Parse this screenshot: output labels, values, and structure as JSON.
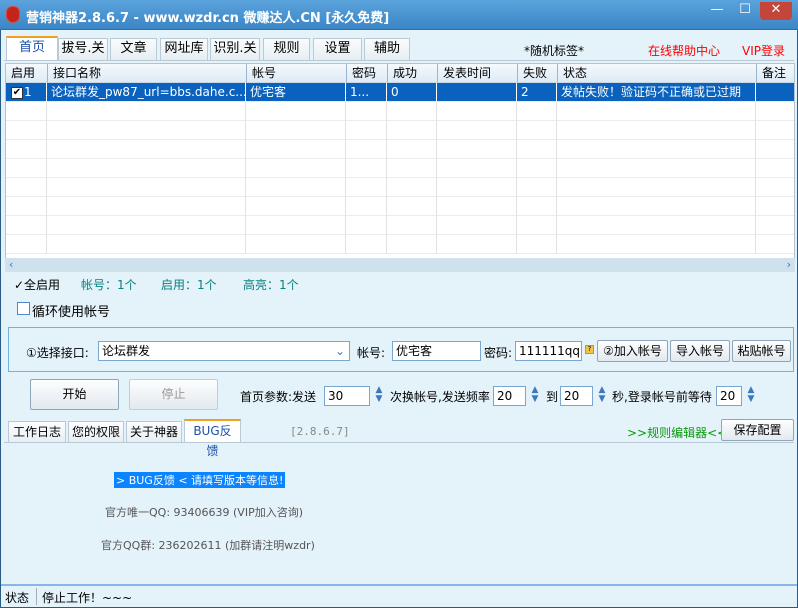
{
  "window": {
    "title": "营销神器2.8.6.7 - www.wzdr.cn 微赚达人.CN [永久免费]",
    "minimize": "—",
    "maximize": "☐",
    "close": "✕"
  },
  "tabs": [
    {
      "label": "首页"
    },
    {
      "label": "拔号.关"
    },
    {
      "label": "文章"
    },
    {
      "label": "网址库"
    },
    {
      "label": "识别.关"
    },
    {
      "label": "规则"
    },
    {
      "label": "设置"
    },
    {
      "label": "辅助"
    }
  ],
  "header_links": {
    "random_tag": "*随机标签*",
    "help": "在线帮助中心",
    "vip": "VIP登录"
  },
  "table": {
    "columns": [
      "启用",
      "接口名称",
      "帐号",
      "密码",
      "成功",
      "发表时间",
      "失败",
      "状态",
      "备注"
    ],
    "rows": [
      {
        "enabled": true,
        "index": "1",
        "name": "论坛群发_pw87_url=bbs.dahe.c...",
        "account": "优宅客",
        "password": "1...",
        "success": "0",
        "time": "",
        "fail": "2",
        "status": "发帖失败！验证码不正确或已过期",
        "note": ""
      }
    ]
  },
  "summary": {
    "enable_all": "✓全启用",
    "accounts": "帐号：1个",
    "enabled": "启用：1个",
    "highlighted": "高亮：1个"
  },
  "loop_accounts": {
    "label": "循环使用帐号",
    "checked": false
  },
  "config": {
    "interface_label": "①选择接口:",
    "interface_value": "论坛群发",
    "account_label": "帐号:",
    "account_value": "优宅客",
    "password_label": "密码:",
    "password_value": "111111qq",
    "add_account": "②加入帐号",
    "import_account": "导入帐号",
    "paste_account": "粘贴帐号"
  },
  "controls": {
    "start": "开始",
    "stop": "停止",
    "params_label": "首页参数:发送",
    "send_count": "30",
    "switch_label": "次换帐号,发送频率",
    "freq_from": "20",
    "to_label": "到",
    "freq_to": "20",
    "wait_label": "秒,登录帐号前等待",
    "wait": "20"
  },
  "bottom_tabs": [
    {
      "label": "工作日志"
    },
    {
      "label": "您的权限"
    },
    {
      "label": "关于神器"
    },
    {
      "label": "BUG反馈"
    }
  ],
  "version": "[2.8.6.7]",
  "rule_editor": ">>规则编辑器<<",
  "save_config": "保存配置",
  "bug_panel": {
    "banner": " > BUG反馈 < 请填写版本等信息! ",
    "qq": "官方唯一QQ: 93406639 (VIP加入咨询)",
    "group": "官方QQ群: 236202611 (加群请注明wzdr)"
  },
  "statusbar": {
    "label": "状态",
    "text": "停止工作！~~~"
  }
}
